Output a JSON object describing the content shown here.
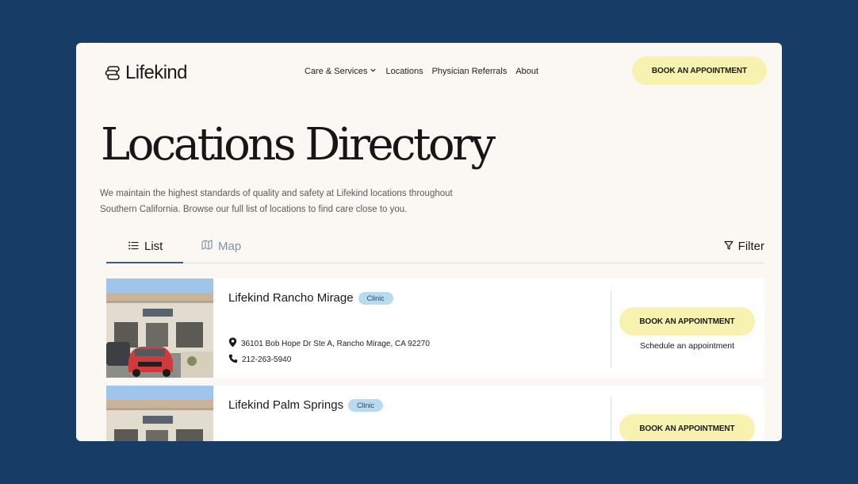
{
  "header": {
    "logo_text": "Lifekind",
    "nav": [
      {
        "label": "Care & Services",
        "has_dropdown": true
      },
      {
        "label": "Locations"
      },
      {
        "label": "Physician Referrals"
      },
      {
        "label": "About"
      }
    ],
    "book_label": "BOOK AN APPOINTMENT"
  },
  "page": {
    "title": "Locations Directory",
    "intro": "We maintain the highest standards of quality and safety at Lifekind locations throughout Southern California. Browse our full list of locations to find care close to you."
  },
  "tabs": {
    "list_label": "List",
    "map_label": "Map",
    "active": "List",
    "filter_label": "Filter"
  },
  "locations": [
    {
      "name": "Lifekind Rancho Mirage",
      "badge": "Clinic",
      "address": "36101 Bob Hope Dr Ste A, Rancho Mirage, CA 92270",
      "phone": "212-263-5940",
      "book_label": "BOOK AN APPOINTMENT",
      "schedule_label": "Schedule an appointment"
    },
    {
      "name": "Lifekind Palm Springs",
      "badge": "Clinic",
      "book_label": "BOOK AN APPOINTMENT"
    }
  ],
  "colors": {
    "background": "#173c66",
    "page": "#fbf8f3",
    "button": "#f7f2b0",
    "badge": "#b9dbef",
    "tab_active": "#3d5d80",
    "tab_inactive": "#8093a8"
  },
  "icons": [
    "logo-icon",
    "chevron-down-icon",
    "list-icon",
    "map-icon",
    "filter-icon",
    "location-pin-icon",
    "phone-icon"
  ]
}
